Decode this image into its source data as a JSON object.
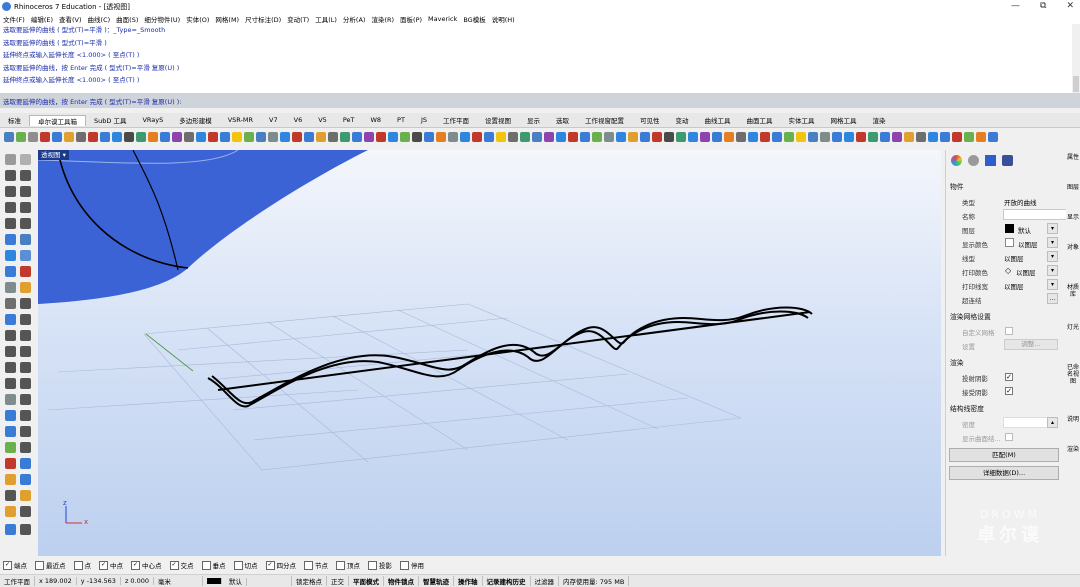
{
  "window": {
    "title": "Rhinoceros 7 Education - [透视图]",
    "minimize": "—",
    "maximize": "⧉",
    "close": "✕"
  },
  "menu": [
    "文件(F)",
    "编辑(E)",
    "查看(V)",
    "曲线(C)",
    "曲面(S)",
    "细分物件(U)",
    "实体(O)",
    "网格(M)",
    "尺寸标注(D)",
    "变动(T)",
    "工具(L)",
    "分析(A)",
    "渲染(R)",
    "面板(P)",
    "Maverick",
    "BG模板",
    "说明(H)"
  ],
  "command_history": [
    "选取要延伸的曲线 ( 型式(T)=平滑 )：_Type=_Smooth",
    "选取要延伸的曲线 ( 型式(T)=平滑 )",
    "延伸终点或输入延伸长度 <1.000> ( 至点(T) )",
    "选取要延伸的曲线，按 Enter 完成 ( 型式(T)=平滑 复原(U) )",
    "延伸终点或输入延伸长度 <1.000> ( 至点(T) )"
  ],
  "command_prompt": "选取要延伸的曲线，按 Enter 完成 ( 型式(T)=平滑 复原(U) ):",
  "toolbar_tabs": [
    "标准",
    "卓尔谟工具箱",
    "SubD 工具",
    "VRayS",
    "多边形建模",
    "VSR-MR",
    "V7",
    "V6",
    "V5",
    "PeT",
    "W8",
    "PT",
    "JS",
    "工作平面",
    "设置视图",
    "显示",
    "选取",
    "工作视窗配置",
    "可见性",
    "变动",
    "曲线工具",
    "曲面工具",
    "实体工具",
    "网格工具",
    "渲染"
  ],
  "active_tab_index": 1,
  "viewport": {
    "label": "透视图 ▾",
    "axis_x": "x",
    "axis_y": "y",
    "axis_z": "z"
  },
  "properties": {
    "section_object": "物件",
    "type_label": "类型",
    "type_value": "开放的曲线",
    "name_label": "名称",
    "name_value": "",
    "layer_label": "图层",
    "layer_value": "默认",
    "display_color_label": "显示颜色",
    "display_color_value": "以图层",
    "linetype_label": "线型",
    "linetype_value": "以图层",
    "print_color_label": "打印颜色",
    "print_color_value": "以图层",
    "print_width_label": "打印线宽",
    "print_width_value": "以图层",
    "hyperlink_label": "超连结",
    "hyperlink_btn": "...",
    "section_mesh": "渲染网格设置",
    "custom_mesh_label": "自定义网格",
    "settings_label": "设置",
    "adjust_btn": "调整...",
    "section_render": "渲染",
    "cast_shadow_label": "投射阴影",
    "receive_shadow_label": "接受阴影",
    "section_isocurve": "结构线密度",
    "density_label": "密度",
    "show_isocurve_label": "显示曲面结...",
    "match_btn": "匹配(M)",
    "details_btn": "详细数据(D)..."
  },
  "right_tabs": [
    "属性",
    "图层",
    "显示",
    "对象",
    "材质库",
    "灯光",
    "已命名视图",
    "说明",
    "渲染"
  ],
  "osnaps": [
    {
      "label": "端点",
      "on": true
    },
    {
      "label": "最近点",
      "on": false
    },
    {
      "label": "点",
      "on": false
    },
    {
      "label": "中点",
      "on": true
    },
    {
      "label": "中心点",
      "on": true
    },
    {
      "label": "交点",
      "on": true
    },
    {
      "label": "垂点",
      "on": false
    },
    {
      "label": "切点",
      "on": false
    },
    {
      "label": "四分点",
      "on": true
    },
    {
      "label": "节点",
      "on": false
    },
    {
      "label": "顶点",
      "on": false
    },
    {
      "label": "投影",
      "on": false
    },
    {
      "label": "停用",
      "on": false
    }
  ],
  "status": {
    "cplane": "工作平面",
    "x": "x 189.002",
    "y": "y -134.563",
    "z": "z 0.000",
    "unit": "毫米",
    "layer": "默认",
    "items": [
      "锁定格点",
      "正交",
      "平面模式",
      "物件锁点",
      "智慧轨迹",
      "操作轴",
      "记录建构历史",
      "过滤器",
      "内存使用量: 795 MB"
    ]
  },
  "watermark": {
    "line1": "DROWM",
    "line2": "卓尔谟"
  },
  "colors": {
    "accent_blue": "#1c3a8c",
    "surface_blue": "#3b63d6",
    "command_text": "#1a2ba8"
  }
}
